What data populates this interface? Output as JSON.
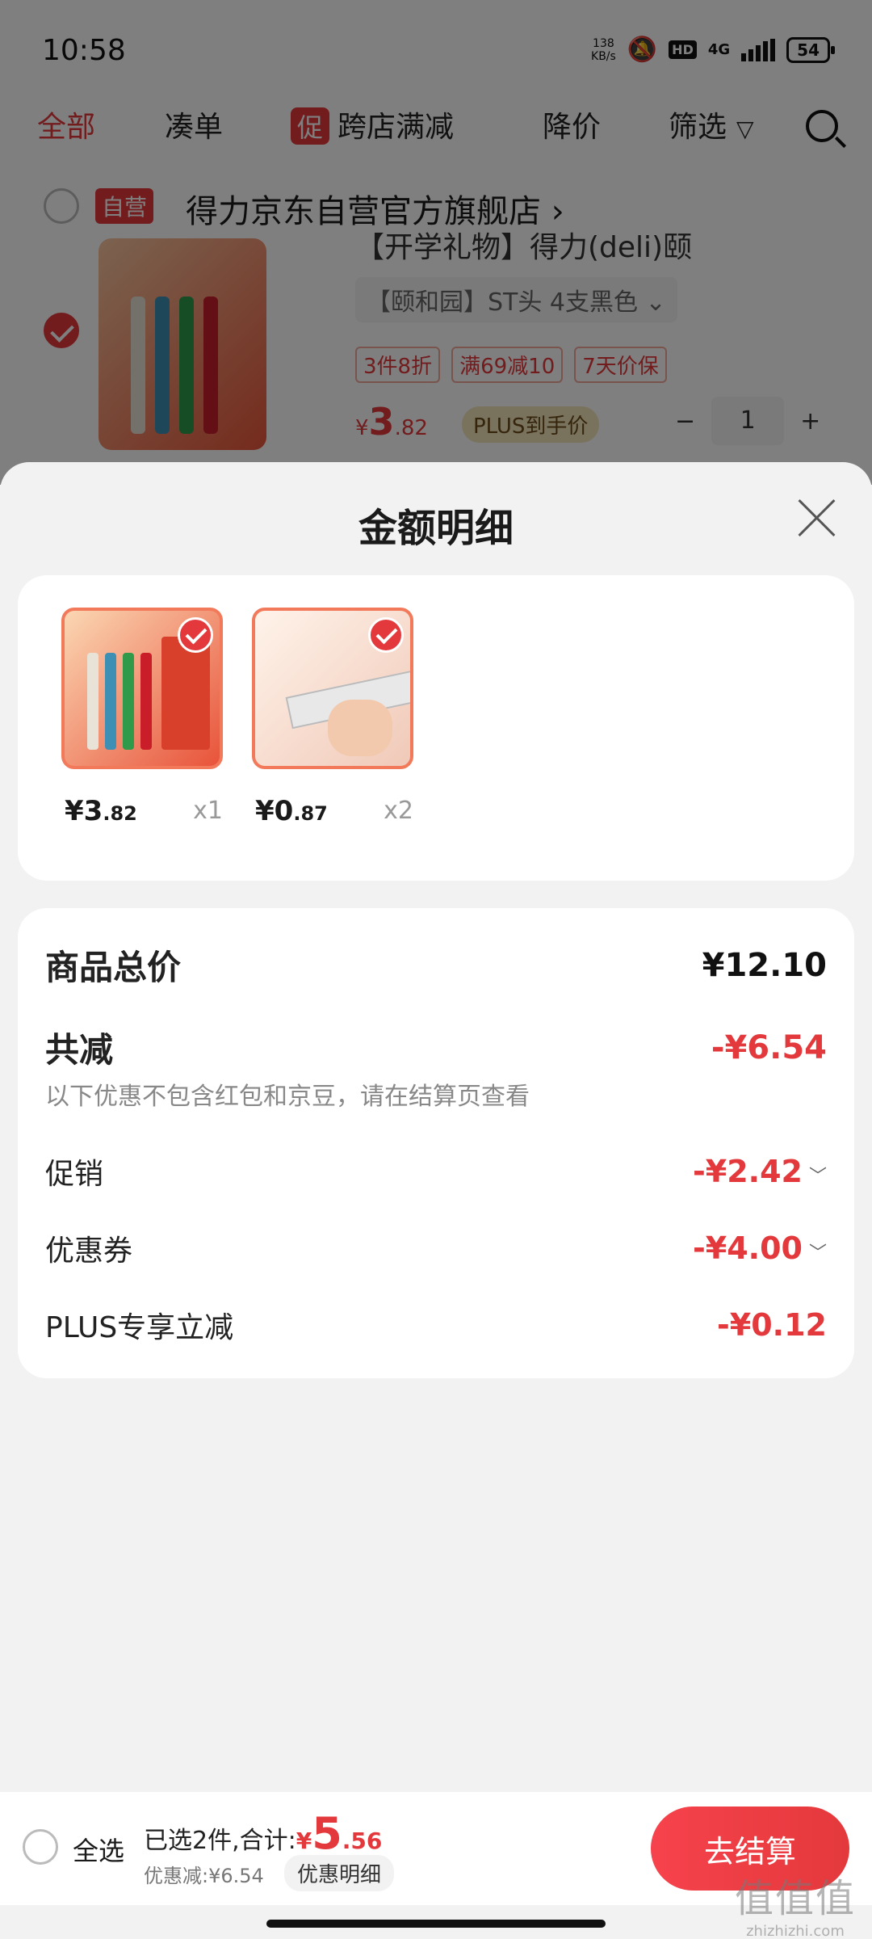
{
  "status_bar": {
    "time": "10:58",
    "net_speed_value": "138",
    "net_speed_unit": "KB/s",
    "hd": "HD",
    "network": "4G",
    "battery": "54"
  },
  "tabs": [
    {
      "label": "全部"
    },
    {
      "label": "凑单"
    },
    {
      "label": "跨店满减",
      "badge": "促"
    },
    {
      "label": "降价"
    },
    {
      "label": "筛选"
    }
  ],
  "store": {
    "badge": "自营",
    "name": "得力京东自营官方旗舰店",
    "chevron": "›"
  },
  "product": {
    "title": "【开学礼物】得力(deli)颐",
    "spec": "【颐和园】ST头 4支黑色",
    "tags": [
      "3件8折",
      "满69减10",
      "7天价保"
    ],
    "price_yen": "¥",
    "price_int": "3",
    "price_dec": ".82",
    "plus_label": "PLUS到手价",
    "qty_minus": "−",
    "qty": "1",
    "qty_plus": "+"
  },
  "sheet": {
    "title": "金额明细",
    "items": [
      {
        "price_main": "¥3",
        "price_dec": ".82",
        "qty": "x1"
      },
      {
        "price_main": "¥0",
        "price_dec": ".87",
        "qty": "x2"
      }
    ],
    "summary": {
      "total_label": "商品总价",
      "total_value": "¥12.10",
      "reduce_label": "共减",
      "reduce_value": "-¥6.54",
      "note": "以下优惠不包含红包和京豆，请在结算页查看",
      "promo_label": "促销",
      "promo_value": "-¥2.42",
      "coupon_label": "优惠券",
      "coupon_value": "-¥4.00",
      "plus_label": "PLUS专享立减",
      "plus_value": "-¥0.12"
    }
  },
  "checkout": {
    "select_all": "全选",
    "selected_prefix": "已选2件,合计:",
    "total_yen": "¥",
    "total_int": "5",
    "total_dec": ".56",
    "discount": "优惠减:¥6.54",
    "detail_chip": "优惠明细",
    "button": "去结算"
  },
  "watermark": {
    "big": "值值值",
    "small": "zhizhizhi.com"
  },
  "colors": {
    "accent": "#e4393c",
    "plus_bg": "#f3e4bb",
    "background": "#f2f2f2"
  },
  "icons": [
    "mute-icon",
    "signal-icon",
    "battery-icon",
    "filter-icon",
    "search-icon",
    "close-icon",
    "check-icon",
    "chevron-down-icon",
    "chevron-right-icon"
  ]
}
